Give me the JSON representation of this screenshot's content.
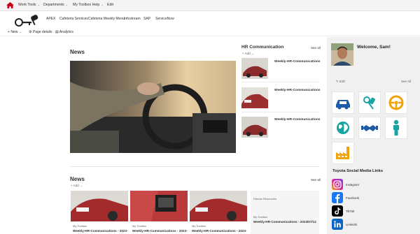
{
  "topnav": {
    "items": [
      {
        "label": "Work Tools"
      },
      {
        "label": "Departments"
      },
      {
        "label": "My Toolbox Help"
      },
      {
        "label": "Edit"
      }
    ]
  },
  "hubnav": {
    "items": [
      "APEX",
      "Cafeteria Services",
      "Cafeteria Weekly Menu",
      "Infostream",
      "SAP",
      "ServiceNow"
    ]
  },
  "command_bar": {
    "new_label": "New",
    "page_details_label": "Page details",
    "analytics_label": "Analytics"
  },
  "news_main": {
    "title": "News"
  },
  "hr": {
    "title": "HR Communication",
    "see_all": "See all",
    "add": "Add",
    "items": [
      {
        "title": "Weekly-HR-Communications"
      },
      {
        "title": "Weekly-HR-Communications"
      },
      {
        "title": "Weekly-HR-Communications"
      }
    ]
  },
  "news_bottom": {
    "title": "News",
    "see_all": "See all",
    "add": "Add",
    "cards": [
      {
        "source": "My Toolbox",
        "title": "Weekly-HR-Communications - 2023-"
      },
      {
        "source": "My Toolbox",
        "title": "Weekly-HR-Communications - 2023-"
      },
      {
        "source": "My Toolbox",
        "title": "Weekly-HR-Communications - 2023-"
      }
    ],
    "text_card": {
      "category": "Human Resources",
      "source": "My Toolbox",
      "title": "Weekly-HR-Communications - 2023/07/12"
    }
  },
  "profile": {
    "welcome": "Welcome, Sam!",
    "edit": "Edit",
    "see_all": "See All"
  },
  "quick_links": {
    "icons": [
      "car-icon",
      "keys-icon",
      "steering-wheel-icon",
      "globe-icon",
      "handshake-icon",
      "person-icon",
      "factory-icon"
    ]
  },
  "social": {
    "title": "Toyota Social Media Links",
    "links": [
      {
        "label": "Instagram"
      },
      {
        "label": "Facebook"
      },
      {
        "label": "TikTok"
      },
      {
        "label": "LinkedIn"
      }
    ]
  },
  "colors": {
    "tile_blue": "#1f5aa6",
    "tile_teal": "#1aa3a3",
    "tile_orange": "#f0a30a"
  }
}
